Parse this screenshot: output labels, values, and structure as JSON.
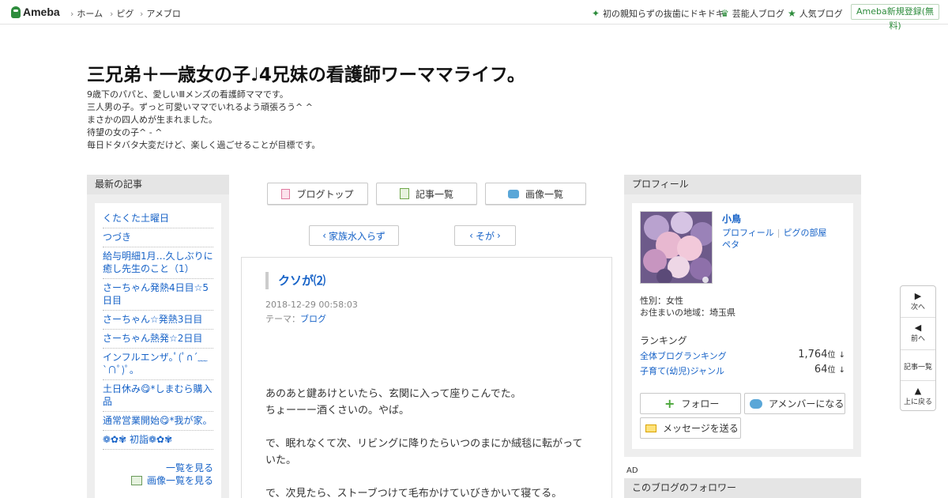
{
  "topbar": {
    "logo": "Ameba",
    "nav": [
      "ホーム",
      "ピグ",
      "アメブロ"
    ],
    "right_links": [
      {
        "icon": "sparkle-icon",
        "glyph": "✦",
        "label": "初の親知らずの抜歯にドキドキ"
      },
      {
        "icon": "crown-icon",
        "glyph": "♛",
        "label": "芸能人ブログ"
      },
      {
        "icon": "star-icon",
        "glyph": "★",
        "label": "人気ブログ"
      }
    ],
    "register": "Ameba新規登録(無料)"
  },
  "header": {
    "title": "三兄弟＋一歳女の子♩4兄妹の看護師ワーママライフ。",
    "description": [
      "9歳下のパパと、愛しいⅢメンズの看護師ママです。",
      "三人男の子。ずっと可愛いママでいれるよう頑張ろう^ ^",
      "まさかの四人めが生まれました。",
      "待望の女の子^ - ^",
      "毎日ドタバタ大変だけど、楽しく過ごせることが目標です。"
    ]
  },
  "left": {
    "heading": "最新の記事",
    "items": [
      "くたくた土曜日",
      "つづき",
      "給与明細1月…久しぶりに癒し先生のこと（1）",
      "さーちゃん発熱4日目☆5日目",
      "さーちゃん☆発熱3日目",
      "さーちゃん熱発☆2日目",
      "インフルエンザ｡ﾟ(ﾟ∩´﹏`∩ﾟ)ﾟ｡",
      "土日休み😋*しまむら購入品",
      "通常営業開始😋*我が家。",
      "❁✿✾ 初詣❁✿✾"
    ],
    "more_list": "一覧を見る",
    "more_images": "画像一覧を見る"
  },
  "center": {
    "buttons": {
      "blog_top": "ブログトップ",
      "articles": "記事一覧",
      "images": "画像一覧"
    },
    "prev": "家族水入らず",
    "next": "そが",
    "article": {
      "title": "クソが⑵",
      "date": "2018-12-29 00:58:03",
      "theme_label": "テーマ：",
      "theme": "ブログ",
      "paragraphs": [
        "あのあと鍵あけといたら、玄関に入って座りこんでた。\nちょーーー酒くさいの。やば。",
        "で、眠れなくて次、リビングに降りたらいつのまにか絨毯に転がっていた。",
        "で、次見たら、ストーブつけて毛布かけていびきかいて寝てる。"
      ]
    }
  },
  "right": {
    "heading": "プロフィール",
    "name": "小鳥",
    "links": [
      "プロフィール",
      "ピグの部屋",
      "ペタ"
    ],
    "gender": "性別：女性",
    "region": "お住まいの地域：埼玉県",
    "ranking_heading": "ランキング",
    "rankings": [
      {
        "label": "全体ブログランキング",
        "value": "1,764",
        "unit": "位",
        "trend": "↓"
      },
      {
        "label": "子育て(幼児)ジャンル",
        "value": "64",
        "unit": "位",
        "trend": "↓"
      }
    ],
    "follow": "フォロー",
    "amember": "アメンバーになる",
    "message": "メッセージを送る",
    "ad": "AD",
    "followers": "このブログのフォロワー"
  },
  "floatnav": {
    "next": "次へ",
    "prev": "前へ",
    "list": "記事一覧",
    "top": "上に戻る"
  },
  "colors": {
    "link": "#1662c7",
    "brand_green": "#2d8c3c",
    "sidebar_bg": "#eeeeee"
  }
}
